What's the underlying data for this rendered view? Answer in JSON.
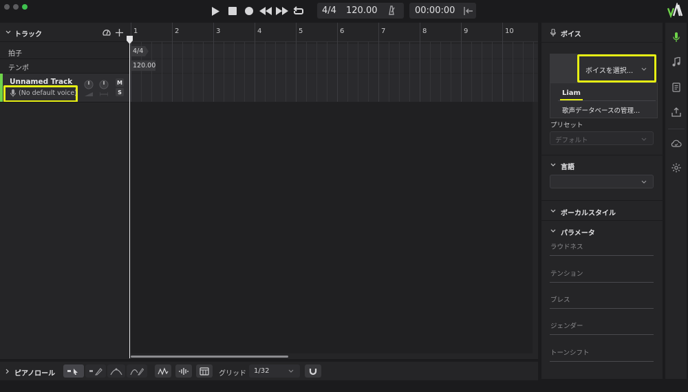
{
  "transport": {
    "time_signature": "4/4",
    "tempo": "120.00",
    "time": "00:00:00"
  },
  "tracks_panel": {
    "title": "トラック",
    "rows": {
      "beat": "拍子",
      "tempo": "テンポ"
    },
    "track": {
      "name": "Unnamed Track",
      "voice": "(No default voice)",
      "mute": "M",
      "solo": "S"
    }
  },
  "timeline": {
    "bars": [
      "1",
      "2",
      "3",
      "4",
      "5",
      "6",
      "7",
      "8",
      "9",
      "10"
    ],
    "beat_marker": "4/4",
    "tempo_marker": "120.00"
  },
  "bottom_bar": {
    "piano_roll": "ピアノロール",
    "grid_label": "グリッド",
    "grid_value": "1/32"
  },
  "voice_panel": {
    "title": "ボイス",
    "select_voice": "ボイスを選択...",
    "dropdown_items": [
      "Liam",
      "歌声データベースの管理..."
    ],
    "preset_label": "プリセット",
    "preset_value": "デフォルト",
    "language_title": "言語",
    "vocal_style_title": "ボーカルスタイル",
    "parameters_title": "パラメータ",
    "params": [
      "ラウドネス",
      "テンション",
      "ブレス",
      "ジェンダー",
      "トーンシフト"
    ]
  },
  "colors": {
    "highlight": "#e6ef14",
    "accent_green": "#6fd44a",
    "background": "#1b1b1d",
    "panel": "#252527"
  }
}
